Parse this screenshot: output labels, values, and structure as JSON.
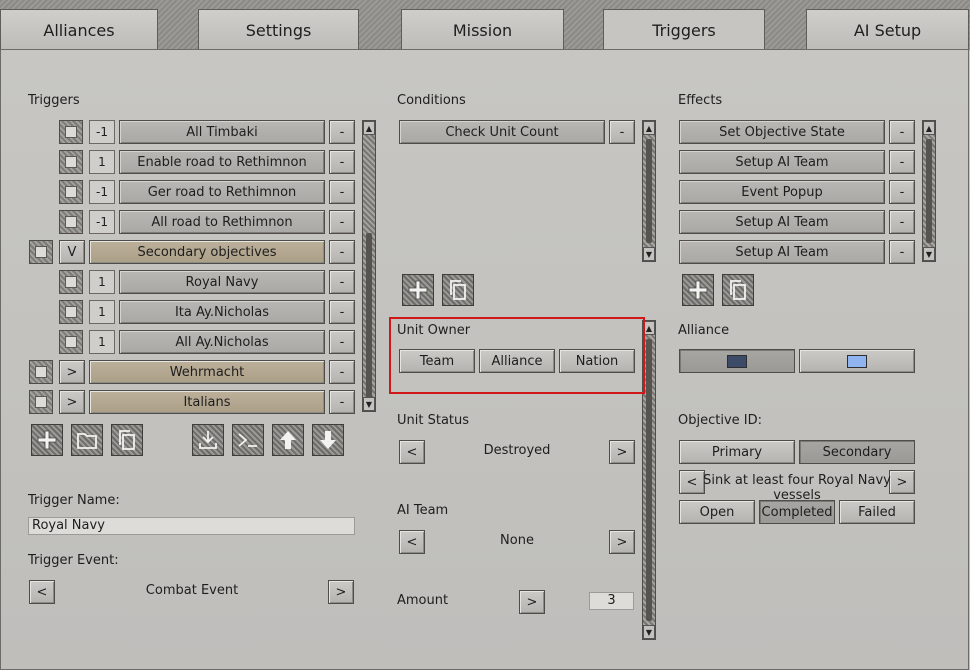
{
  "tabs": [
    {
      "label": "Alliances",
      "active": false
    },
    {
      "label": "Settings",
      "active": false
    },
    {
      "label": "Mission",
      "active": false
    },
    {
      "label": "Triggers",
      "active": true
    },
    {
      "label": "AI Setup",
      "active": false
    }
  ],
  "triggers": {
    "heading": "Triggers",
    "items": [
      {
        "num": "-1",
        "label": "All Timbaki",
        "type": "item"
      },
      {
        "num": "1",
        "label": "Enable road to Rethimnon",
        "type": "item"
      },
      {
        "num": "-1",
        "label": "Ger road to Rethimnon",
        "type": "item"
      },
      {
        "num": "-1",
        "label": "All road to Rethimnon",
        "type": "item"
      },
      {
        "num": "V",
        "label": "Secondary objectives",
        "type": "group"
      },
      {
        "num": "1",
        "label": "Royal Navy",
        "type": "item"
      },
      {
        "num": "1",
        "label": "Ita Ay.Nicholas",
        "type": "item"
      },
      {
        "num": "1",
        "label": "All Ay.Nicholas",
        "type": "item"
      },
      {
        "num": ">",
        "label": "Wehrmacht",
        "type": "group"
      },
      {
        "num": ">",
        "label": "Italians",
        "type": "group"
      }
    ],
    "remove_label": "-",
    "name_label": "Trigger Name:",
    "name_value": "Royal Navy",
    "event_label": "Trigger Event:",
    "event_value": "Combat Event",
    "prev": "<",
    "next": ">"
  },
  "conditions": {
    "heading": "Conditions",
    "items": [
      "Check Unit Count"
    ],
    "remove_label": "-",
    "unit_owner": {
      "label": "Unit Owner",
      "options": [
        "Team",
        "Alliance",
        "Nation"
      ]
    },
    "unit_status": {
      "label": "Unit Status",
      "value": "Destroyed"
    },
    "ai_team": {
      "label": "AI Team",
      "value": "None"
    },
    "amount": {
      "label": "Amount",
      "value": "3"
    },
    "prev": "<",
    "next": ">"
  },
  "effects": {
    "heading": "Effects",
    "items": [
      "Set Objective State",
      "Setup AI Team",
      "Event Popup",
      "Setup AI Team",
      "Setup AI Team"
    ],
    "remove_label": "-",
    "alliance": {
      "label": "Alliance",
      "color_a": "#3c4c68",
      "color_b": "#8fb4ef"
    },
    "objective": {
      "label": "Objective ID:",
      "types": [
        "Primary",
        "Secondary"
      ],
      "selected_type": "Secondary",
      "description": "Sink at least four Royal Navy vessels",
      "prev": "<",
      "next": ">",
      "states": [
        "Open",
        "Completed",
        "Failed"
      ],
      "selected_state": "Completed"
    }
  },
  "highlight_color": "#d01818"
}
